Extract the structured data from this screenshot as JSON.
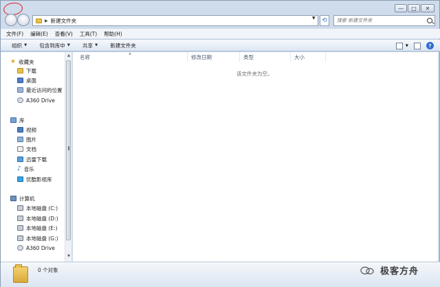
{
  "window": {
    "controls": {
      "minimize": "—",
      "maximize": "□",
      "close": "✕"
    }
  },
  "address_bar": {
    "path": "新建文件夹",
    "search_placeholder": "搜索 新建文件夹"
  },
  "menu": [
    "文件(F)",
    "编辑(E)",
    "查看(V)",
    "工具(T)",
    "帮助(H)"
  ],
  "commands": [
    {
      "label": "组织",
      "has_dropdown": true
    },
    {
      "label": "包含到库中",
      "has_dropdown": true
    },
    {
      "label": "共享",
      "has_dropdown": true
    },
    {
      "label": "新建文件夹",
      "has_dropdown": false
    }
  ],
  "nav_tree": {
    "favorites": {
      "label": "收藏夹",
      "items": [
        "下载",
        "桌面",
        "最近访问的位置",
        "A360 Drive"
      ]
    },
    "libraries": {
      "label": "库",
      "items": [
        "视频",
        "图片",
        "文档",
        "迅雷下载",
        "音乐",
        "优酷影视库"
      ]
    },
    "computer": {
      "label": "计算机",
      "items": [
        "本地磁盘 (C:)",
        "本地磁盘 (D:)",
        "本地磁盘 (E:)",
        "本地磁盘 (G:)",
        "A360 Drive"
      ]
    }
  },
  "columns": [
    "名称",
    "修改日期",
    "类型",
    "大小"
  ],
  "empty_message": "该文件夹为空。",
  "status": {
    "item_count": "0 个对象"
  },
  "watermark": {
    "text": "极客方舟",
    "logo": "wechat-logo"
  },
  "icons": {
    "back": "back-arrow-icon",
    "forward": "forward-arrow-icon",
    "search": "search-icon",
    "help": "help-icon"
  },
  "colors": {
    "window_frame": "#cfdcec",
    "annotation": "#e02020",
    "folder": "#e8c24a",
    "accent": "#2f6fcf"
  }
}
